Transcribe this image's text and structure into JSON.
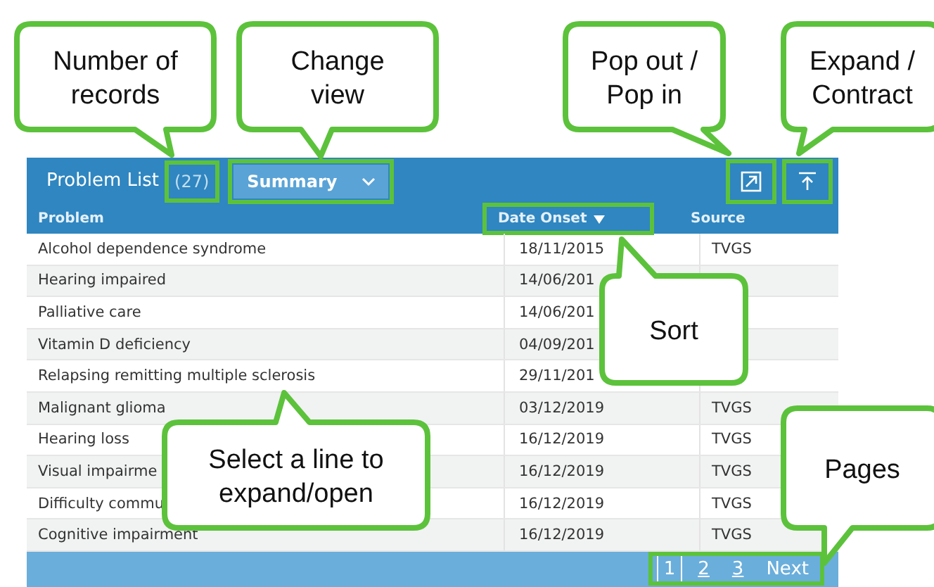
{
  "panel": {
    "title": "Problem List",
    "count": "(27)",
    "view_select": {
      "value": "Summary"
    }
  },
  "table": {
    "columns": [
      {
        "label": "Problem",
        "sorted": false
      },
      {
        "label": "Date Onset",
        "sorted": true
      },
      {
        "label": "Source",
        "sorted": false
      }
    ],
    "rows": [
      {
        "cells": [
          "Alcohol dependence syndrome",
          "18/11/2015",
          "TVGS"
        ]
      },
      {
        "cells": [
          "Hearing impaired",
          "14/06/201",
          ""
        ]
      },
      {
        "cells": [
          "Palliative care",
          "14/06/201",
          ""
        ]
      },
      {
        "cells": [
          "Vitamin D deficiency",
          "04/09/201",
          ""
        ]
      },
      {
        "cells": [
          "Relapsing remitting multiple sclerosis",
          "29/11/201",
          ""
        ]
      },
      {
        "cells": [
          "Malignant glioma",
          "03/12/2019",
          "TVGS"
        ]
      },
      {
        "cells": [
          "Hearing loss",
          "16/12/2019",
          "TVGS"
        ]
      },
      {
        "cells": [
          "Visual impairme",
          "16/12/2019",
          "TVGS"
        ]
      },
      {
        "cells": [
          "Difficulty commu",
          "16/12/2019",
          "TVGS"
        ]
      },
      {
        "cells": [
          "Cognitive impairment",
          "16/12/2019",
          "TVGS"
        ]
      }
    ]
  },
  "pagination": {
    "pages": [
      {
        "label": "1",
        "selected": true
      },
      {
        "label": "2",
        "selected": false
      },
      {
        "label": "3",
        "selected": false
      }
    ],
    "next": "Next"
  },
  "callouts": [
    {
      "lines": [
        "Number of",
        "records"
      ]
    },
    {
      "lines": [
        "Change",
        "view"
      ]
    },
    {
      "lines": [
        "Pop out /",
        "Pop in"
      ]
    },
    {
      "lines": [
        "Expand /",
        "Contract"
      ]
    },
    {
      "lines": [
        "Sort"
      ]
    },
    {
      "lines": [
        "Select a line to",
        "expand/open"
      ]
    },
    {
      "lines": [
        "Pages"
      ]
    }
  ]
}
